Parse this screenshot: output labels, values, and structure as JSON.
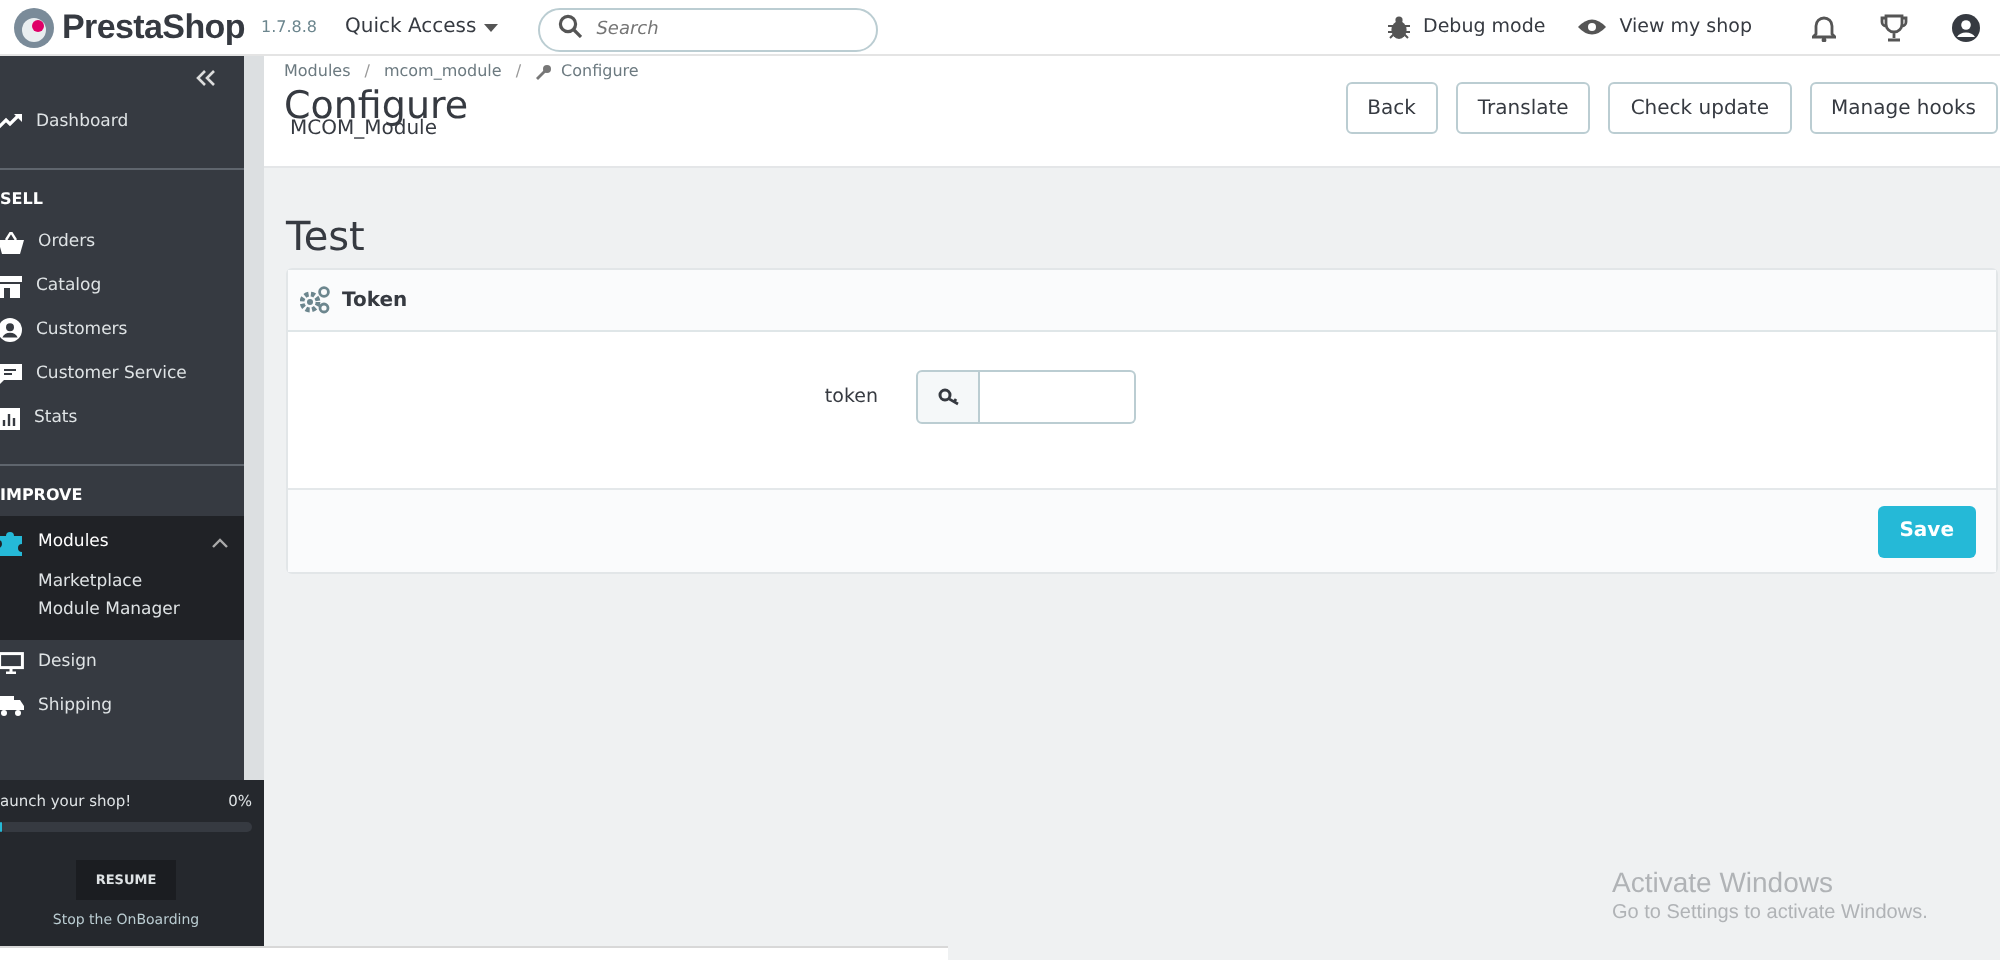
{
  "header": {
    "logo": "PrestaShop",
    "version": "1.7.8.8",
    "quick_access": "Quick Access",
    "search": {
      "placeholder": "Search"
    },
    "debug_mode": "Debug mode",
    "view_shop": "View my shop"
  },
  "sidebar": {
    "items": [
      {
        "kind": "link",
        "label": "Dashboard",
        "selected": false
      },
      {
        "kind": "heading",
        "label": "SELL"
      },
      {
        "kind": "link",
        "label": "Orders",
        "selected": false
      },
      {
        "kind": "link",
        "label": "Catalog",
        "selected": false
      },
      {
        "kind": "link",
        "label": "Customers",
        "selected": false
      },
      {
        "kind": "link",
        "label": "Customer Service",
        "selected": false
      },
      {
        "kind": "link",
        "label": "Stats",
        "selected": false
      },
      {
        "kind": "heading",
        "label": "IMPROVE"
      },
      {
        "kind": "link",
        "label": "Modules",
        "selected": true,
        "expanded": true,
        "children": [
          {
            "label": "Marketplace"
          },
          {
            "label": "Module Manager"
          }
        ]
      },
      {
        "kind": "link",
        "label": "Design",
        "selected": false
      },
      {
        "kind": "link",
        "label": "Shipping",
        "selected": false
      }
    ]
  },
  "onboarding": {
    "title": "aunch your shop!",
    "percent": "0%",
    "level": 0,
    "resume": "RESUME",
    "stop": "Stop the OnBoarding"
  },
  "breadcrumb": [
    {
      "label": "Modules",
      "separator": "/"
    },
    {
      "label": "mcom_module",
      "separator": "/"
    },
    {
      "label": "Configure"
    }
  ],
  "page": {
    "title": "Configure",
    "subtitle": "MCOM_Module",
    "buttons": [
      "Back",
      "Translate",
      "Check update",
      "Manage hooks"
    ]
  },
  "content": {
    "heading": "Test",
    "panel": {
      "title": "Token",
      "fields": [
        {
          "label": "token"
        }
      ],
      "save": "Save"
    }
  },
  "os_notice": {
    "title": "Activate Windows",
    "text": "Go to Settings to activate Windows."
  }
}
